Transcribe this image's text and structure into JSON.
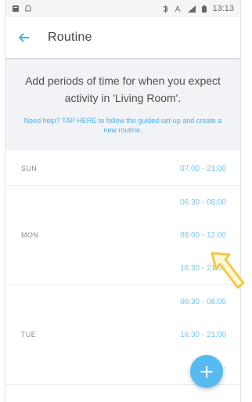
{
  "status_bar": {
    "time": "13:13"
  },
  "header": {
    "title": "Routine"
  },
  "info": {
    "text": "Add periods of time for when you expect activity in 'Living Room'.",
    "help": "Need help? TAP HERE to follow the guided set-up and create a new routine."
  },
  "schedule": [
    {
      "day": "SUN",
      "times": [
        "07:00 - 21:00"
      ]
    },
    {
      "day": "MON",
      "times": [
        "06:30 - 08:00",
        "09:00 - 12:00",
        "16:30 - 21:00"
      ]
    },
    {
      "day": "TUE",
      "times": [
        "06:30 - 08:00",
        "16:30 - 21:00",
        "06:30 -"
      ]
    }
  ],
  "fab": {
    "label": "+"
  },
  "colors": {
    "accent": "#56bbf0",
    "time": "#77c4ee",
    "card_bg": "#f1f3f6",
    "annotation_arrow": "#f2c84b"
  },
  "icons": {
    "back": "arrow-left-icon",
    "add": "plus-icon",
    "bluetooth": "bluetooth-icon",
    "signal": "signal-icon",
    "battery": "battery-icon",
    "notification": "notification-icon",
    "alarm": "alarm-icon"
  }
}
